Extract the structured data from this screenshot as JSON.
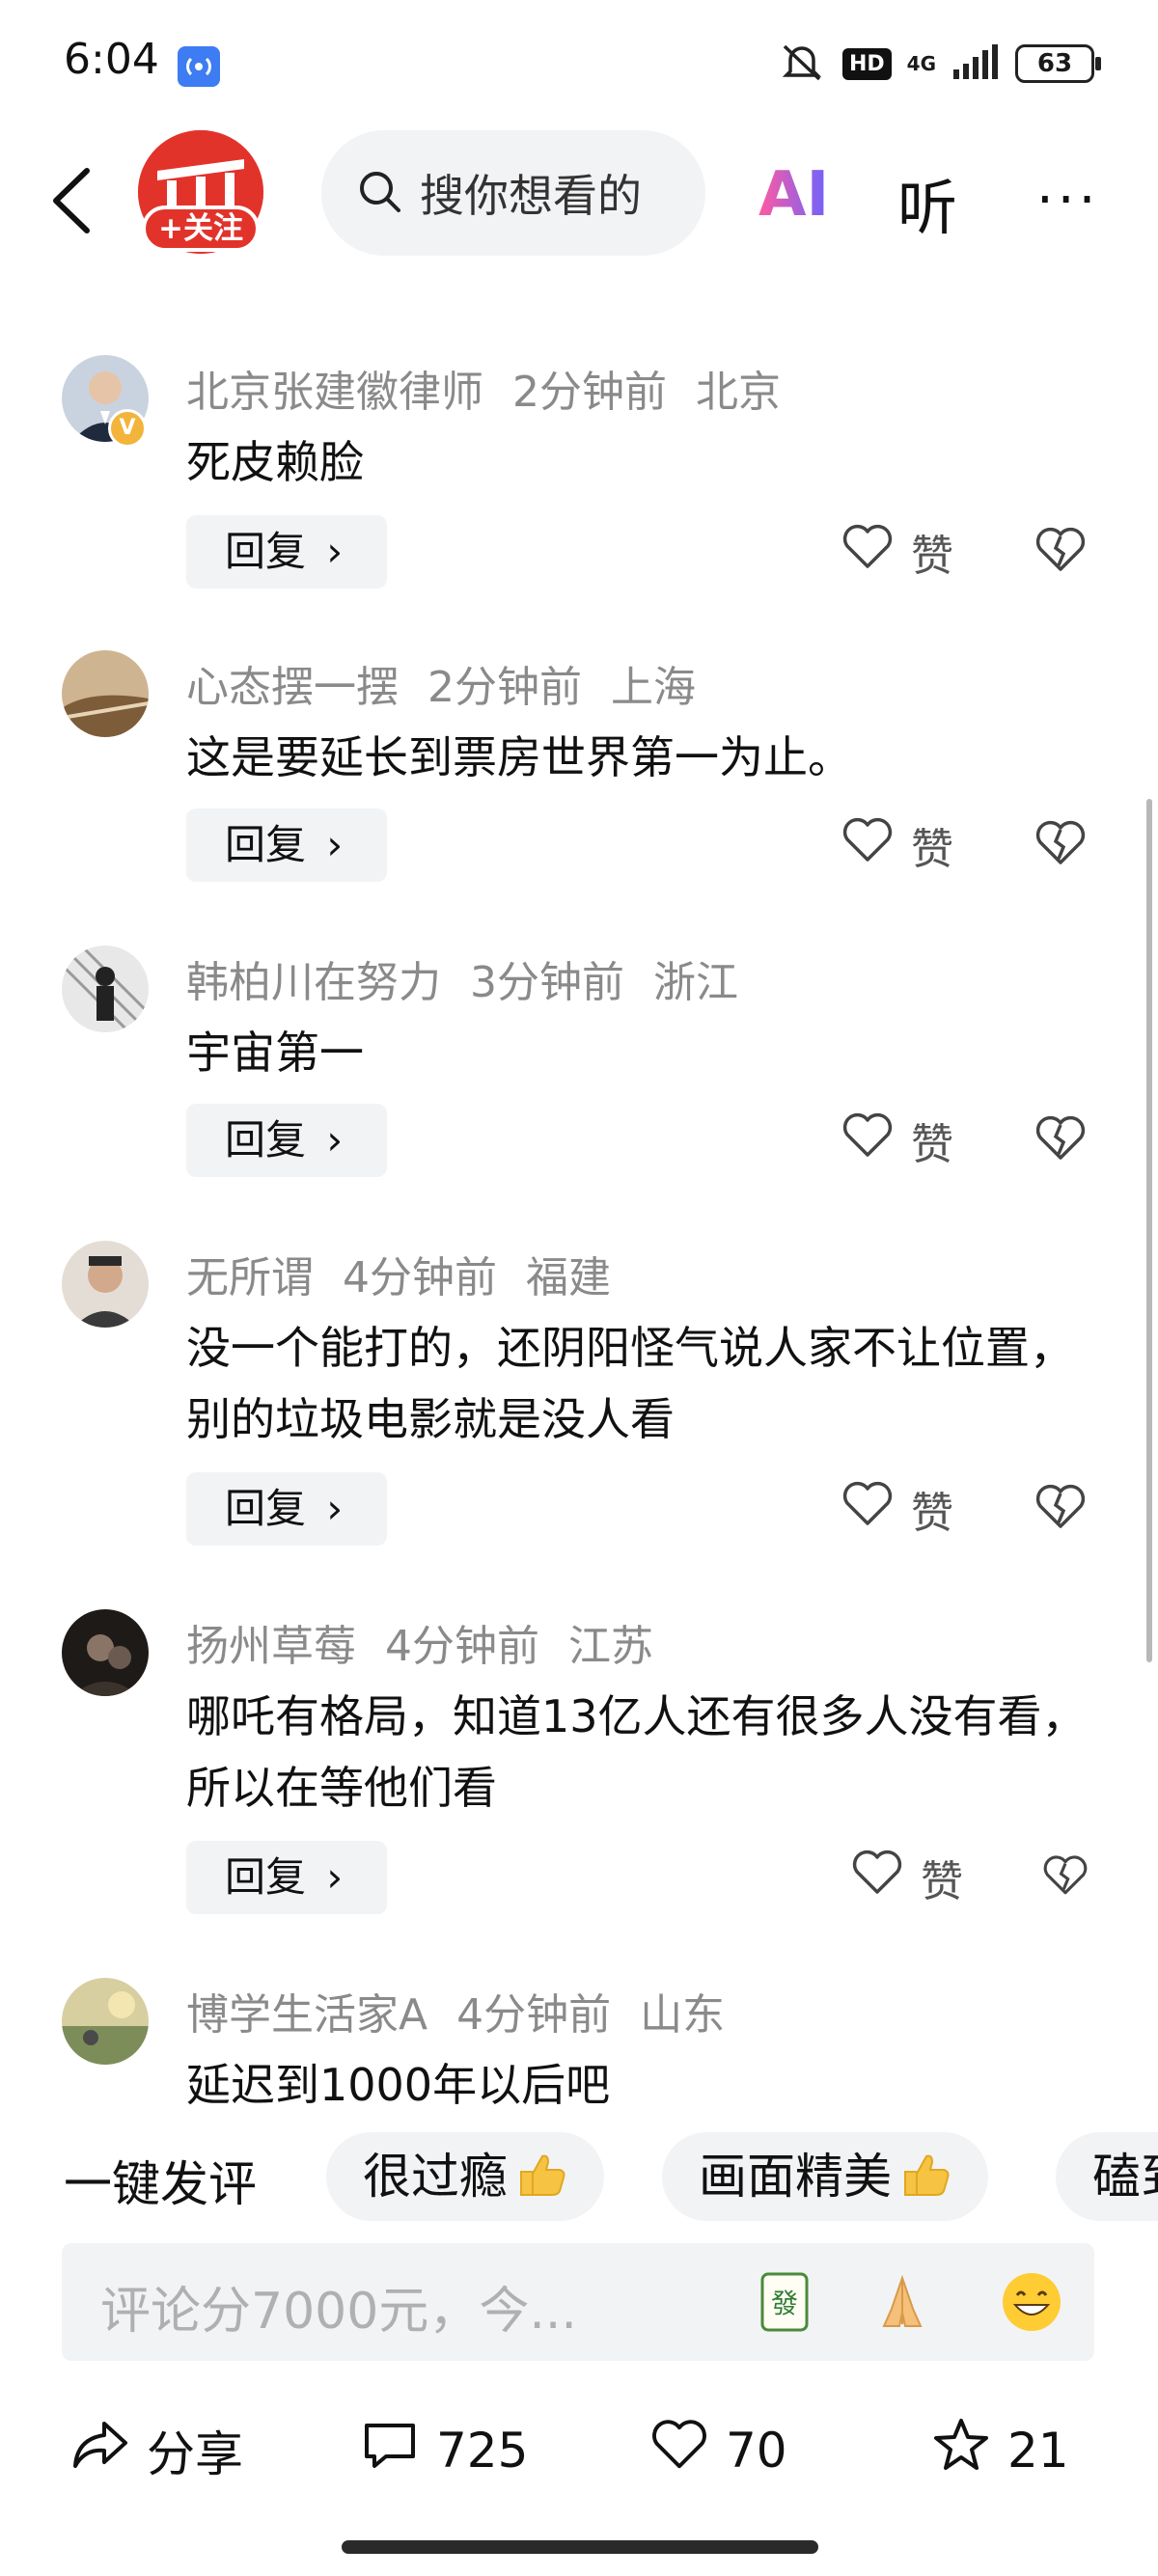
{
  "status_bar": {
    "time": "6:04",
    "hd": "HD",
    "network": "4G",
    "battery": "63"
  },
  "header": {
    "follow_label": "+关注",
    "search_placeholder": "搜你想看的",
    "ai_label": "AI",
    "listen_label": "听",
    "more_label": "···"
  },
  "comments": [
    {
      "user": "北京张建徽律师",
      "time": "2分钟前",
      "location": "北京",
      "text": "死皮赖脸",
      "reply": "回复",
      "like": "赞",
      "avatar_color": "#c9d3df",
      "verified": true
    },
    {
      "user": "心态摆一摆",
      "time": "2分钟前",
      "location": "上海",
      "text": "这是要延长到票房世界第一为止。",
      "reply": "回复",
      "like": "赞",
      "avatar_color": "#a58863"
    },
    {
      "user": "韩柏川在努力",
      "time": "3分钟前",
      "location": "浙江",
      "text": "宇宙第一",
      "reply": "回复",
      "like": "赞",
      "avatar_color": "#6c6c6c"
    },
    {
      "user": "无所谓",
      "time": "4分钟前",
      "location": "福建",
      "text": "没一个能打的，还阴阳怪气说人家不让位置，别的垃圾电影就是没人看",
      "reply": "回复",
      "like": "赞",
      "avatar_color": "#d8c7b8"
    },
    {
      "user": "扬州草莓",
      "time": "4分钟前",
      "location": "江苏",
      "text": "哪吒有格局，知道13亿人还有很多人没有看，所以在等他们看",
      "reply": "回复",
      "like": "赞",
      "avatar_color": "#2e2723"
    },
    {
      "user": "博学生活家A",
      "time": "4分钟前",
      "location": "山东",
      "text": "延迟到1000年以后吧",
      "avatar_color": "#b7a46a"
    }
  ],
  "quick_reply": {
    "title": "一键发评",
    "chips": [
      "很过瘾",
      "画面精美",
      "磕到"
    ]
  },
  "comment_input": {
    "placeholder": "评论分7000元，今..."
  },
  "bottom_bar": {
    "share_label": "分享",
    "comment_count": "725",
    "like_count": "70",
    "favorite_count": "21"
  },
  "colors": {
    "brand_red": "#e2332b",
    "meta_gray": "#8a8a8a",
    "chip_bg": "#f2f3f5"
  }
}
